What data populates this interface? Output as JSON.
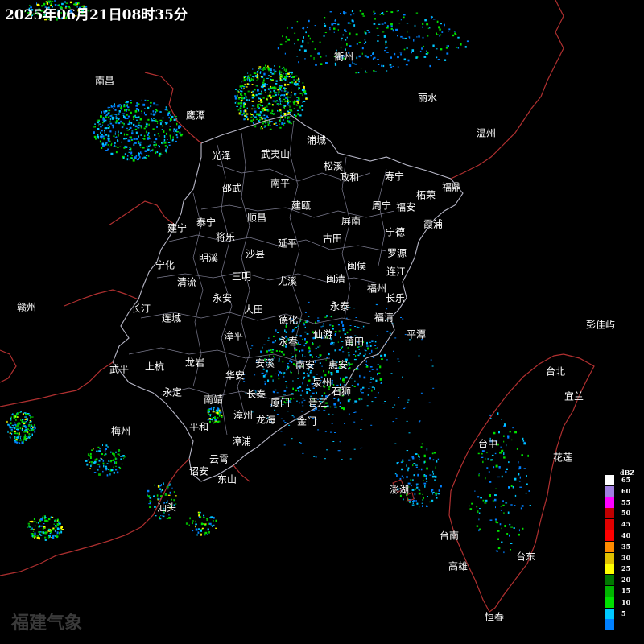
{
  "timestamp": "2025年06月21日08时35分",
  "watermark": "福建气象",
  "legend": {
    "unit": "dBZ",
    "levels": [
      {
        "label": "65",
        "color": "#ffffff"
      },
      {
        "label": "60",
        "color": "#a07fe0"
      },
      {
        "label": "55",
        "color": "#ff00ff"
      },
      {
        "label": "50",
        "color": "#c00000"
      },
      {
        "label": "45",
        "color": "#e00000"
      },
      {
        "label": "40",
        "color": "#ff0000"
      },
      {
        "label": "35",
        "color": "#ff8c00"
      },
      {
        "label": "30",
        "color": "#e0c000"
      },
      {
        "label": "25",
        "color": "#ffff00"
      },
      {
        "label": "20",
        "color": "#007800"
      },
      {
        "label": "15",
        "color": "#00b400"
      },
      {
        "label": "10",
        "color": "#00e000"
      },
      {
        "label": "5",
        "color": "#00c8ff"
      },
      {
        "label": "",
        "color": "#0080ff"
      }
    ]
  },
  "cities": [
    "南昌",
    "衢州",
    "丽水",
    "鹰潭",
    "温州",
    "光泽",
    "武夷山",
    "浦城",
    "松溪",
    "政和",
    "寿宁",
    "福鼎",
    "柘荣",
    "邵武",
    "南平",
    "周宁",
    "福安",
    "霞浦",
    "泰宁",
    "顺昌",
    "建瓯",
    "屏南",
    "宁德",
    "建宁",
    "将乐",
    "延平",
    "古田",
    "明溪",
    "沙县",
    "罗源",
    "宁化",
    "闽侯",
    "连江",
    "清流",
    "三明",
    "尤溪",
    "闽清",
    "福州",
    "永安",
    "长乐",
    "赣州",
    "长汀",
    "大田",
    "永泰",
    "连城",
    "福清",
    "德化",
    "仙游",
    "平潭",
    "彭佳屿",
    "漳平",
    "永春",
    "莆田",
    "武平",
    "上杭",
    "龙岩",
    "安溪",
    "南安",
    "惠安",
    "台北",
    "华安",
    "泉州",
    "石狮",
    "永定",
    "长泰",
    "厦门",
    "晋江",
    "宜兰",
    "南靖",
    "漳州",
    "平和",
    "龙海",
    "金门",
    "梅州",
    "漳浦",
    "台中",
    "云霄",
    "花莲",
    "诏安",
    "澎湖",
    "东山",
    "汕头",
    "台南",
    "台东",
    "高雄",
    "恒春"
  ]
}
